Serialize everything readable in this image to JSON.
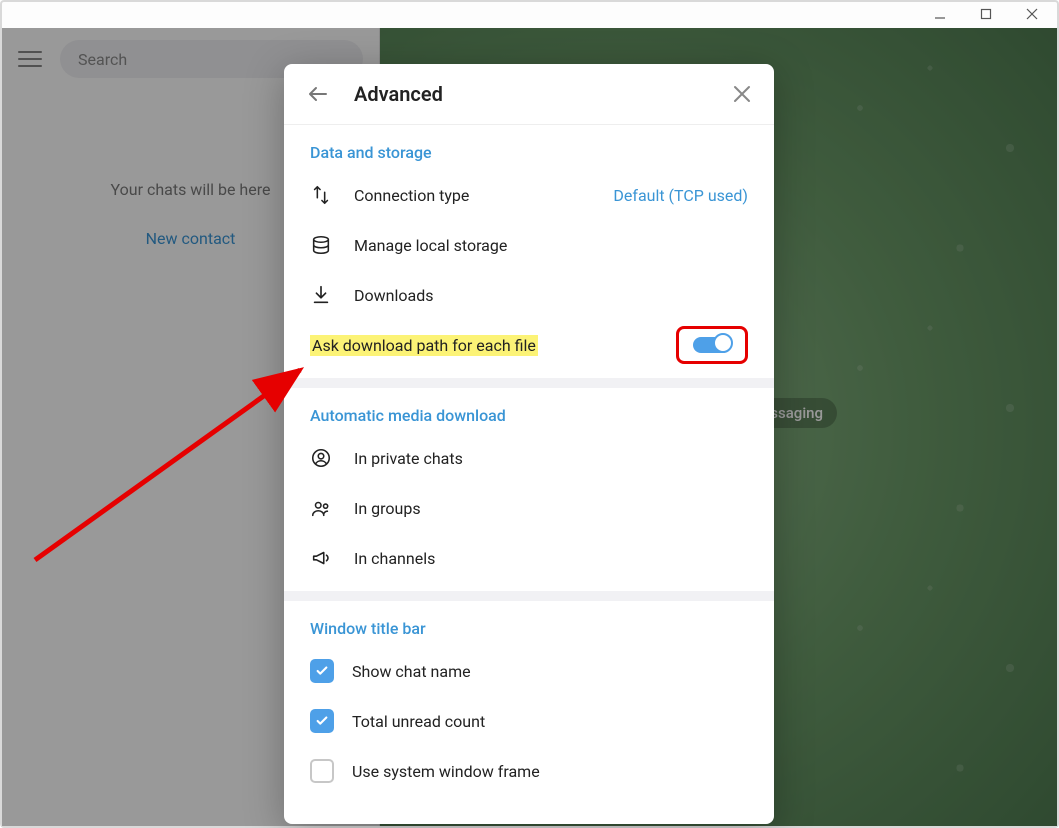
{
  "titlebar": {},
  "sidebar": {
    "search_placeholder": "Search",
    "empty_text": "Your chats will be here",
    "new_contact": "New contact"
  },
  "right_panel": {
    "badge_fragment": "essaging"
  },
  "modal": {
    "title": "Advanced",
    "sections": {
      "data_storage": {
        "title": "Data and storage",
        "connection_type": {
          "label": "Connection type",
          "value": "Default (TCP used)"
        },
        "manage_local_storage": "Manage local storage",
        "downloads": "Downloads",
        "ask_download_path": "Ask download path for each file"
      },
      "auto_media": {
        "title": "Automatic media download",
        "in_private_chats": "In private chats",
        "in_groups": "In groups",
        "in_channels": "In channels"
      },
      "window_title_bar": {
        "title": "Window title bar",
        "show_chat_name": "Show chat name",
        "total_unread_count": "Total unread count",
        "use_system_window_frame": "Use system window frame"
      }
    }
  }
}
